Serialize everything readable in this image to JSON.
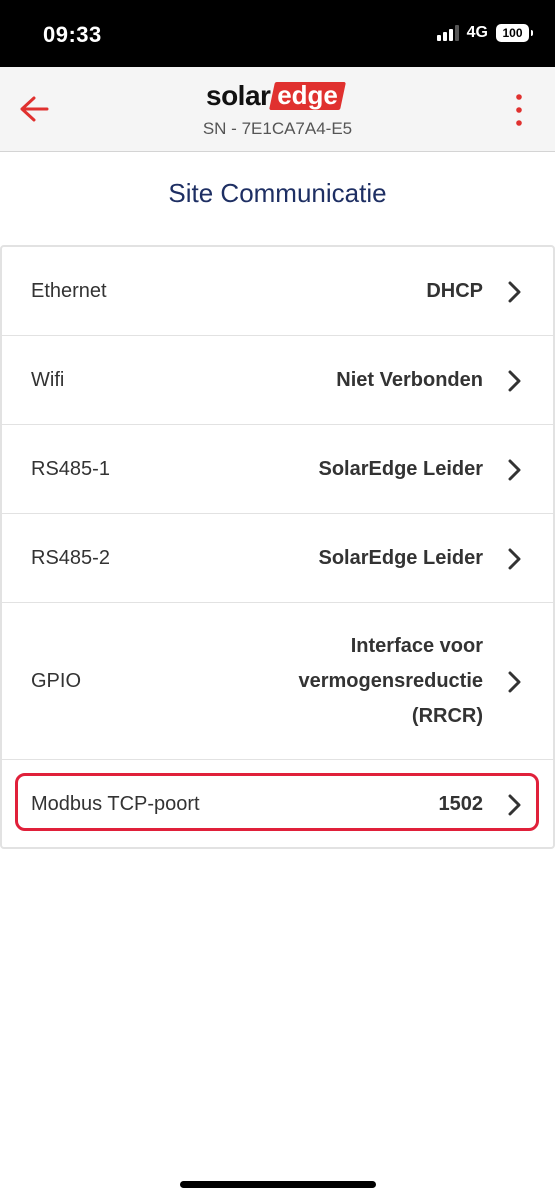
{
  "status_bar": {
    "time": "09:33",
    "network": "4G",
    "battery": "100"
  },
  "header": {
    "logo_solar": "solar",
    "logo_edge": "edge",
    "serial": "SN - 7E1CA7A4-E5",
    "accent_color": "#e0312f"
  },
  "page": {
    "title": "Site Communicatie",
    "title_color": "#1e2f63"
  },
  "rows": [
    {
      "label": "Ethernet",
      "value": "DHCP"
    },
    {
      "label": "Wifi",
      "value": "Niet Verbonden"
    },
    {
      "label": "RS485-1",
      "value": "SolarEdge Leider"
    },
    {
      "label": "RS485-2",
      "value": "SolarEdge Leider"
    },
    {
      "label": "GPIO",
      "value_lines": [
        "Interface voor",
        "vermogensreductie",
        "(RRCR)"
      ]
    },
    {
      "label": "Modbus TCP-poort",
      "value": "1502",
      "highlighted": true
    }
  ]
}
